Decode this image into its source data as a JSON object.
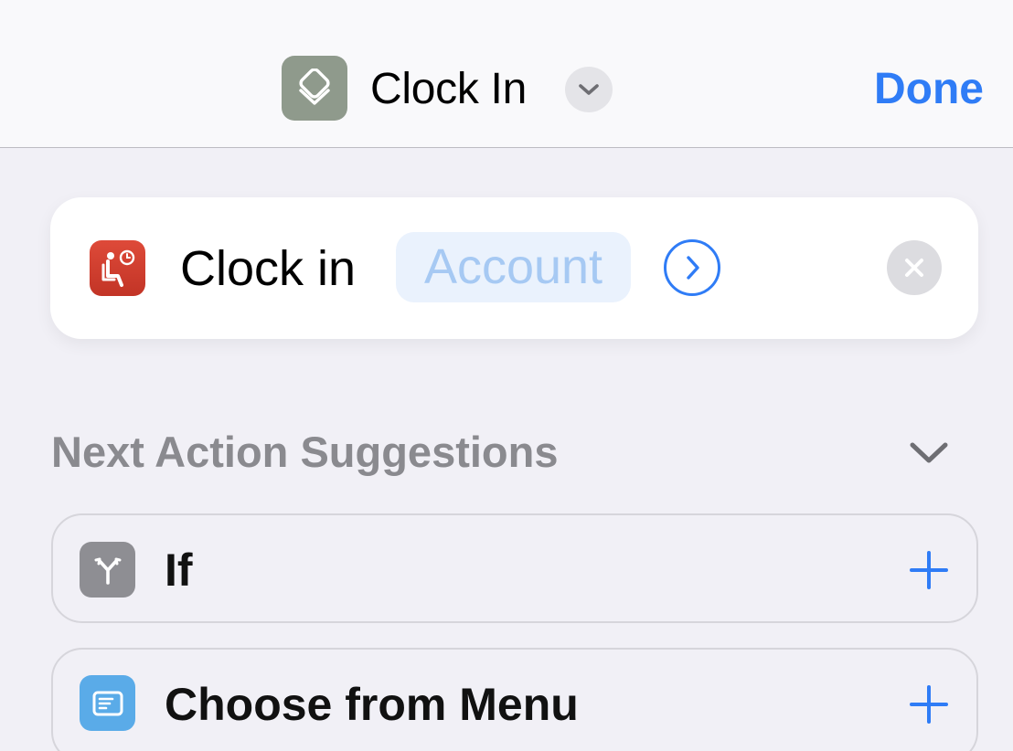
{
  "header": {
    "title": "Clock In",
    "done_label": "Done",
    "shortcut_icon": "layers-icon",
    "shortcut_icon_color": "#8F9A8C",
    "accent_color": "#2F7CF6"
  },
  "action": {
    "label": "Clock in",
    "parameter": "Account",
    "app_icon": "seated-person-clock-icon",
    "app_icon_color": "#D03F31"
  },
  "suggestions": {
    "title": "Next Action Suggestions",
    "items": [
      {
        "label": "If",
        "icon": "branch-icon",
        "icon_color": "#8E8E93"
      },
      {
        "label": "Choose from Menu",
        "icon": "menu-list-icon",
        "icon_color": "#5AABE8"
      }
    ]
  }
}
